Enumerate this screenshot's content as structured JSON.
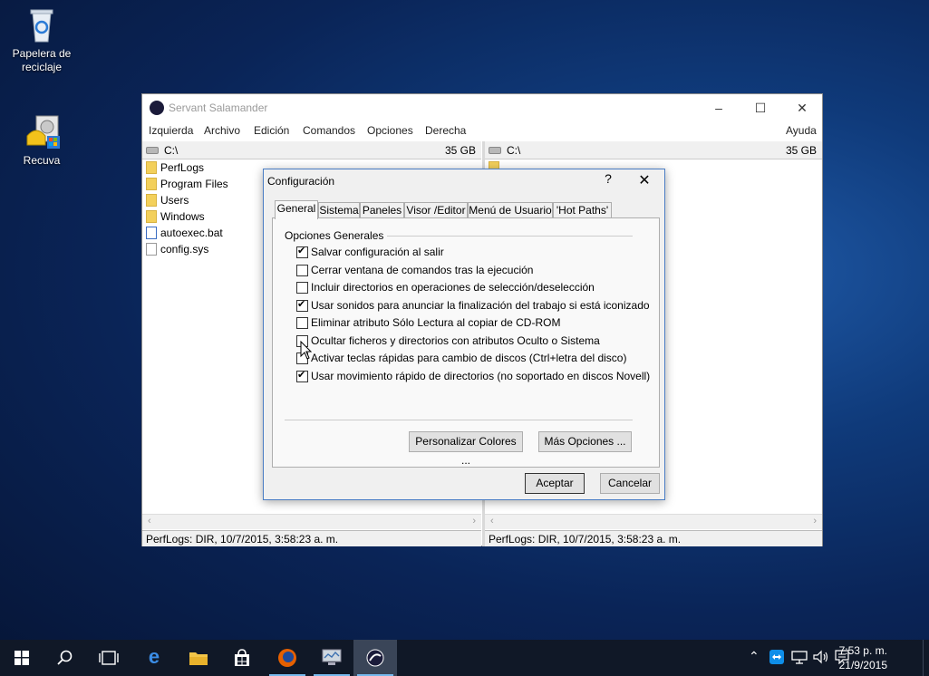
{
  "desktop": {
    "icons": [
      {
        "label_line1": "Papelera de",
        "label_line2": "reciclaje",
        "icon": "recycle-bin-icon"
      },
      {
        "label_line1": "Recuva",
        "label_line2": "",
        "icon": "recuva-icon"
      }
    ]
  },
  "window": {
    "title": "Servant Salamander",
    "menu": [
      "Izquierda",
      "Archivo",
      "Edición",
      "Comandos",
      "Opciones",
      "Derecha"
    ],
    "help_menu": "Ayuda",
    "left_panel": {
      "path": "C:\\",
      "size": "35 GB",
      "files": [
        {
          "name": "PerfLogs",
          "type": "folder"
        },
        {
          "name": "Program Files",
          "type": "folder"
        },
        {
          "name": "Users",
          "type": "folder"
        },
        {
          "name": "Windows",
          "type": "folder"
        },
        {
          "name": "autoexec.bat",
          "type": "bat"
        },
        {
          "name": "config.sys",
          "type": "sys"
        }
      ],
      "status": "PerfLogs: DIR, 10/7/2015, 3:58:23 a. m."
    },
    "right_panel": {
      "path": "C:\\",
      "size": "35 GB",
      "status": "PerfLogs: DIR, 10/7/2015, 3:58:23 a. m."
    }
  },
  "dialog": {
    "title": "Configuración",
    "help": "?",
    "close": "✕",
    "tabs": [
      "General",
      "Sistema",
      "Paneles",
      "Visor /Editor",
      "Menú de Usuario",
      "'Hot Paths'"
    ],
    "active_tab": "General",
    "group_label": "Opciones Generales",
    "options": [
      {
        "label": "Salvar configuración al salir",
        "checked": true
      },
      {
        "label": "Cerrar ventana de comandos tras la ejecución",
        "checked": false
      },
      {
        "label": "Incluir directorios en operaciones de selección/deselección",
        "checked": false
      },
      {
        "label": "Usar sonidos para anunciar la finalización del trabajo si está iconizado",
        "checked": true
      },
      {
        "label": "Eliminar atributo Sólo Lectura al copiar de CD-ROM",
        "checked": false
      },
      {
        "label": "Ocultar ficheros y directorios con atributos Oculto o Sistema",
        "checked": false
      },
      {
        "label": "Activar teclas rápidas para cambio de discos (Ctrl+letra del disco)",
        "checked": false
      },
      {
        "label": "Usar movimiento rápido de directorios (no soportado en discos Novell)",
        "checked": true
      }
    ],
    "btn_colors": "Personalizar Colores ...",
    "btn_more": "Más Opciones ...",
    "btn_ok": "Aceptar",
    "btn_cancel": "Cancelar"
  },
  "taskbar": {
    "time": "7:53 p. m.",
    "date": "21/9/2015"
  }
}
